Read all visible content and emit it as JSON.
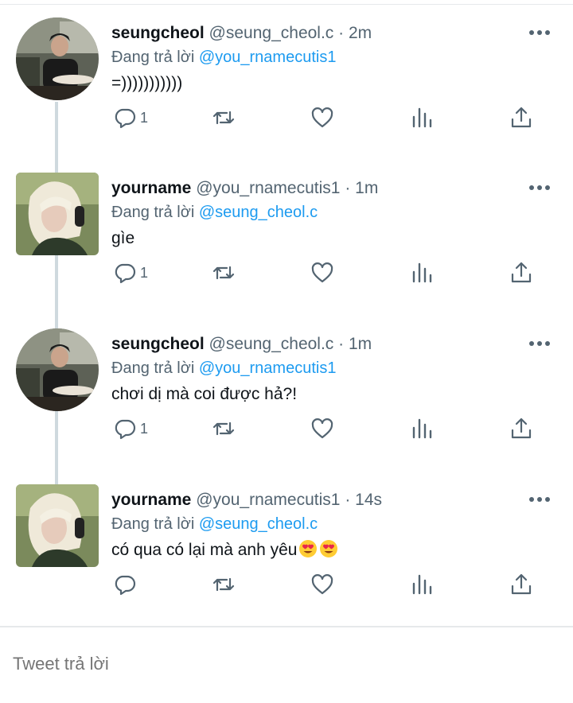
{
  "tweets": [
    {
      "name": "seungcheol",
      "handle": "@seung_cheol.c",
      "dot": "·",
      "time": "2m",
      "reply_prefix": "Đang trả lời",
      "reply_to": "@you_rnamecutis1",
      "text": "=)))))))))))",
      "reply_count": "1",
      "avatar": "seungcheol"
    },
    {
      "name": "yourname",
      "handle": "@you_rnamecutis1",
      "dot": "·",
      "time": "1m",
      "reply_prefix": "Đang trả lời",
      "reply_to": "@seung_cheol.c",
      "text": "gìe",
      "reply_count": "1",
      "avatar": "yourname"
    },
    {
      "name": "seungcheol",
      "handle": "@seung_cheol.c",
      "dot": "·",
      "time": "1m",
      "reply_prefix": "Đang trả lời",
      "reply_to": "@you_rnamecutis1",
      "text": "chơi dị mà coi được hả?!",
      "reply_count": "1",
      "avatar": "seungcheol"
    },
    {
      "name": "yourname",
      "handle": "@you_rnamecutis1",
      "dot": "·",
      "time": "14s",
      "reply_prefix": "Đang trả lời",
      "reply_to": "@seung_cheol.c",
      "text": "có qua có lại mà anh yêu",
      "emoji": [
        "heart-eyes-emoji",
        "heart-eyes-emoji"
      ],
      "reply_count": "",
      "avatar": "yourname"
    }
  ],
  "icons": {
    "reply": "reply-icon",
    "retweet": "retweet-icon",
    "like": "heart-icon",
    "views": "views-icon",
    "share": "share-icon",
    "more": "more-icon"
  },
  "composer": {
    "placeholder": "Tweet trả lời"
  },
  "colors": {
    "link": "#1d9bf0",
    "secondary": "#536471",
    "thread_line": "#cfd9de"
  }
}
